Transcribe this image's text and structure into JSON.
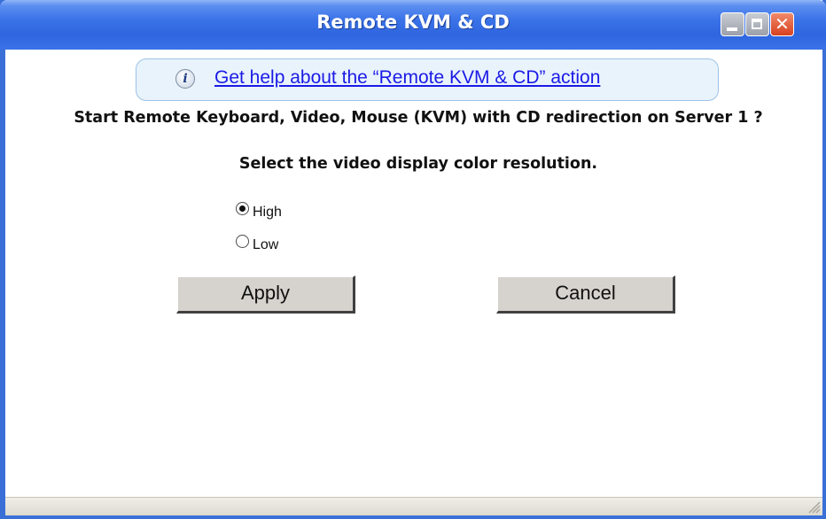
{
  "window": {
    "title": "Remote KVM & CD",
    "controls": {
      "minimize": "minimize-icon",
      "maximize": "maximize-icon",
      "close": "close-icon"
    }
  },
  "help": {
    "icon": "info-icon",
    "icon_glyph": "i",
    "link_text": "Get help about the “Remote KVM & CD” action"
  },
  "question": "Start Remote Keyboard, Video, Mouse (KVM) with CD redirection on Server 1 ?",
  "resolution": {
    "label": "Select the video display color resolution.",
    "options": [
      {
        "label": "High",
        "selected": true
      },
      {
        "label": "Low",
        "selected": false
      }
    ]
  },
  "buttons": {
    "apply": "Apply",
    "cancel": "Cancel"
  },
  "colors": {
    "titlebar": "#2f66df",
    "link": "#1a1ae6",
    "button_face": "#d6d3ce",
    "help_bg": "#e9f3fc"
  }
}
